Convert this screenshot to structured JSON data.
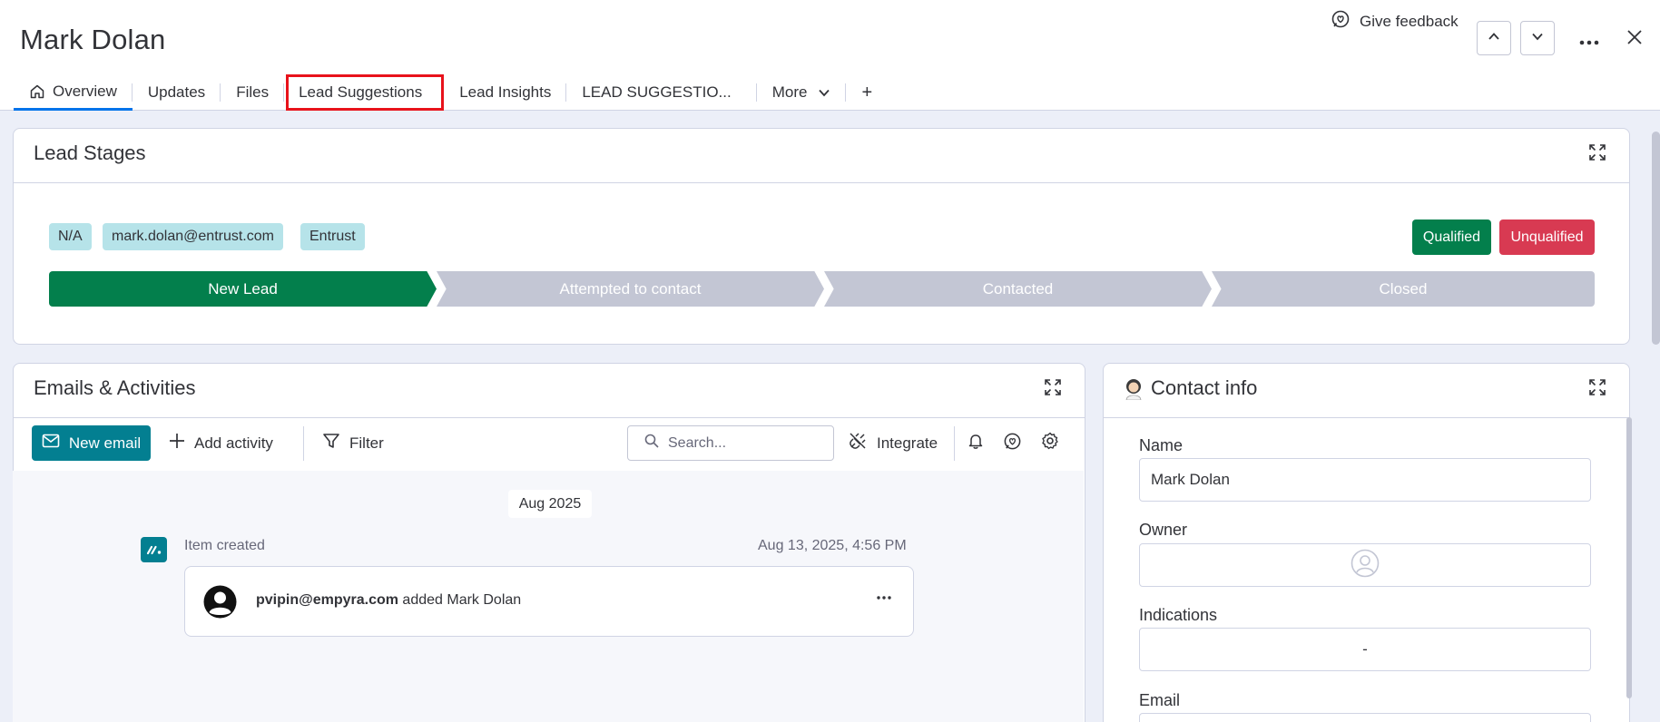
{
  "header": {
    "title": "Mark Dolan",
    "feedback_label": "Give feedback"
  },
  "tabs": [
    {
      "label": "Overview",
      "icon": "home-icon"
    },
    {
      "label": "Updates"
    },
    {
      "label": "Files"
    },
    {
      "label": "Lead Suggestions"
    },
    {
      "label": "Lead Insights"
    },
    {
      "label": "LEAD SUGGESTIO..."
    },
    {
      "label": "More",
      "icon": "chevron-down-icon"
    },
    {
      "label": "+"
    }
  ],
  "lead_stages": {
    "title": "Lead Stages",
    "chips": [
      "N/A",
      "mark.dolan@entrust.com",
      "Entrust"
    ],
    "qualified_label": "Qualified",
    "unqualified_label": "Unqualified",
    "stages": [
      "New Lead",
      "Attempted to contact",
      "Contacted",
      "Closed"
    ],
    "active_stage": "New Lead",
    "colors": {
      "active": "#037f4c",
      "inactive": "#c3c6d4",
      "qualified": "#037f4c",
      "unqualified": "#d83a52"
    }
  },
  "emails": {
    "title": "Emails & Activities",
    "new_email_label": "New email",
    "add_activity_label": "Add activity",
    "filter_label": "Filter",
    "search_placeholder": "Search...",
    "integrate_label": "Integrate",
    "month": "Aug 2025",
    "item_label": "Item created",
    "item_date": "Aug 13, 2025, 4:56 PM",
    "activity_user": "pvipin@empyra.com",
    "activity_text": " added Mark Dolan"
  },
  "contact": {
    "title": "Contact info",
    "fields": [
      {
        "label": "Name",
        "value": "Mark Dolan"
      },
      {
        "label": "Owner",
        "value": ""
      },
      {
        "label": "Indications",
        "value": "-"
      },
      {
        "label": "Email",
        "value": ""
      }
    ]
  }
}
